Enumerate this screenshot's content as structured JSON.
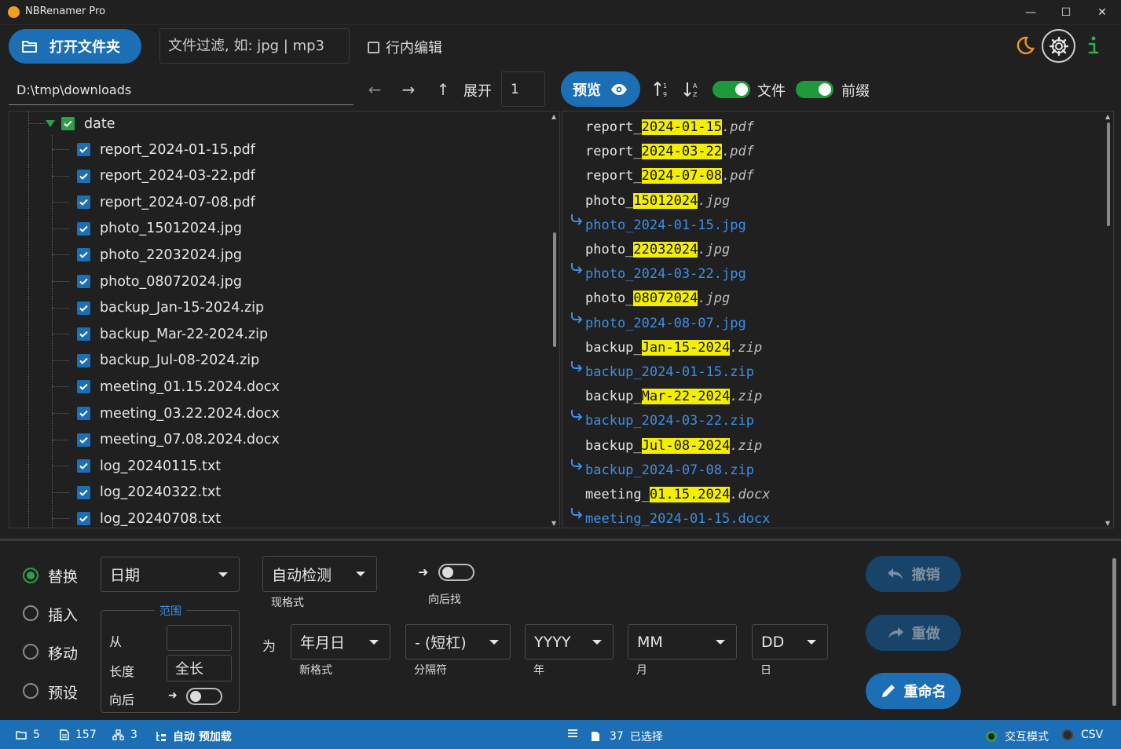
{
  "window": {
    "title": "NBRenamer Pro",
    "minimize": "—",
    "maximize": "☐",
    "close": "✕"
  },
  "toolbar": {
    "open_folder": "打开文件夹",
    "filter_placeholder": "文件过滤, 如: jpg | mp3",
    "inline_edit": "行内编辑",
    "path": "D:\\tmp\\downloads",
    "expand_label": "展开",
    "expand_value": "1",
    "preview": "预览",
    "files_toggle": "文件",
    "prefix_toggle": "前缀"
  },
  "tree": {
    "folder": "date",
    "items": [
      "report_2024-01-15.pdf",
      "report_2024-03-22.pdf",
      "report_2024-07-08.pdf",
      "photo_15012024.jpg",
      "photo_22032024.jpg",
      "photo_08072024.jpg",
      "backup_Jan-15-2024.zip",
      "backup_Mar-22-2024.zip",
      "backup_Jul-08-2024.zip",
      "meeting_01.15.2024.docx",
      "meeting_03.22.2024.docx",
      "meeting_07.08.2024.docx",
      "log_20240115.txt",
      "log_20240322.txt",
      "log_20240708.txt"
    ]
  },
  "preview": {
    "rows": [
      {
        "kind": "orig",
        "pre": "report_",
        "hl": "2024-01-15",
        "ext": ".pdf"
      },
      {
        "kind": "orig",
        "pre": "report_",
        "hl": "2024-03-22",
        "ext": ".pdf"
      },
      {
        "kind": "orig",
        "pre": "report_",
        "hl": "2024-07-08",
        "ext": ".pdf"
      },
      {
        "kind": "orig",
        "pre": "photo_",
        "hl": "15012024",
        "ext": ".jpg"
      },
      {
        "kind": "new",
        "text": "photo_2024-01-15.jpg"
      },
      {
        "kind": "orig",
        "pre": "photo_",
        "hl": "22032024",
        "ext": ".jpg"
      },
      {
        "kind": "new",
        "text": "photo_2024-03-22.jpg"
      },
      {
        "kind": "orig",
        "pre": "photo_",
        "hl": "08072024",
        "ext": ".jpg"
      },
      {
        "kind": "new",
        "text": "photo_2024-08-07.jpg"
      },
      {
        "kind": "orig",
        "pre": "backup_",
        "hl": "Jan-15-2024",
        "ext": ".zip"
      },
      {
        "kind": "new",
        "text": "backup_2024-01-15.zip"
      },
      {
        "kind": "orig",
        "pre": "backup_",
        "hl": "Mar-22-2024",
        "ext": ".zip"
      },
      {
        "kind": "new",
        "text": "backup_2024-03-22.zip"
      },
      {
        "kind": "orig",
        "pre": "backup_",
        "hl": "Jul-08-2024",
        "ext": ".zip"
      },
      {
        "kind": "new",
        "text": "backup_2024-07-08.zip"
      },
      {
        "kind": "orig",
        "pre": "meeting_",
        "hl": "01.15.2024",
        "ext": ".docx"
      },
      {
        "kind": "new",
        "text": "meeting_2024-01-15.docx"
      }
    ]
  },
  "modes": {
    "replace": "替换",
    "insert": "插入",
    "move": "移动",
    "preset": "预设"
  },
  "options": {
    "type_value": "日期",
    "format_value": "自动检测",
    "format_label": "现格式",
    "search_back_label": "向后找",
    "range_title": "范围",
    "from_label": "从",
    "from_value": "",
    "length_label": "长度",
    "length_value": "全长",
    "backward_label": "向后",
    "as_label": "为",
    "new_format_value": "年月日",
    "new_format_label": "新格式",
    "separator_value": "- (短杠)",
    "separator_label": "分隔符",
    "year_value": "YYYY",
    "year_label": "年",
    "month_value": "MM",
    "month_label": "月",
    "day_value": "DD",
    "day_label": "日"
  },
  "actions": {
    "undo": "撤销",
    "redo": "重做",
    "rename": "重命名"
  },
  "status": {
    "folders": "5",
    "files": "157",
    "depth": "3",
    "auto_preload": "自动 预加载",
    "selected_count": "37",
    "selected_label": "已选择",
    "interactive_mode": "交互模式",
    "csv": "CSV"
  },
  "colors": {
    "accent": "#1c6fb5",
    "toggle_on": "#1e9a3a",
    "highlight": "#f4ef00",
    "new_name": "#3b8fe6"
  }
}
